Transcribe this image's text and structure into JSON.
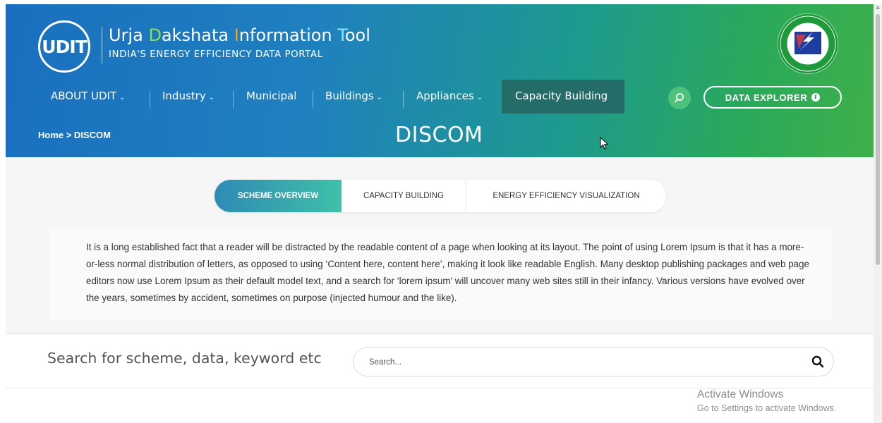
{
  "brand": {
    "logo_text": "UDIT",
    "title_parts": [
      {
        "text": "Urja ",
        "cls": ""
      },
      {
        "text": "D",
        "cls": "hl-g"
      },
      {
        "text": "akshata ",
        "cls": ""
      },
      {
        "text": "I",
        "cls": "hl-o"
      },
      {
        "text": "nformation ",
        "cls": ""
      },
      {
        "text": "T",
        "cls": "hl-c"
      },
      {
        "text": "ool",
        "cls": ""
      }
    ],
    "subtitle": "INDIA'S ENERGY EFFICIENCY DATA PORTAL"
  },
  "nav": {
    "items": [
      {
        "label": "ABOUT UDIT",
        "chevron": true
      },
      {
        "label": "Industry",
        "chevron": true
      },
      {
        "label": "Municipal",
        "chevron": false
      },
      {
        "label": "Buildings",
        "chevron": true
      },
      {
        "label": "Appliances",
        "chevron": true
      },
      {
        "label": "Capacity Building",
        "chevron": false,
        "active": true
      }
    ],
    "data_explorer": "DATA EXPLORER"
  },
  "breadcrumb": "Home > DISCOM",
  "page_title": "DISCOM",
  "tabs": [
    {
      "label": "SCHEME OVERVIEW",
      "active": true
    },
    {
      "label": "CAPACITY BUILDING",
      "active": false
    },
    {
      "label": "ENERGY EFFICIENCY VISUALIZATION",
      "active": false
    }
  ],
  "overview_text": "It is a long established fact that a reader will be distracted by the readable content of a page when looking at its layout. The point of using Lorem Ipsum is that it has a more-or-less normal distribution of letters, as opposed to using ‘Content here, content here’, making it look like readable English. Many desktop publishing packages and web page editors now use Lorem Ipsum as their default model text, and a search for ‘lorem ipsum’ will uncover many web sites still in their infancy. Various versions have evolved over the years, sometimes by accident, sometimes on purpose (injected humour and the like).",
  "search": {
    "label": "Search for scheme, data, keyword etc",
    "placeholder": "Search..."
  },
  "watermark": {
    "line1": "Activate Windows",
    "line2": "Go to Settings to activate Windows."
  },
  "colors": {
    "gradient_start": "#1a6fbf",
    "gradient_end": "#3fb04a",
    "nav_active": "#236c68",
    "tab_active_start": "#2f8ab5",
    "tab_active_end": "#3fc0a8"
  }
}
